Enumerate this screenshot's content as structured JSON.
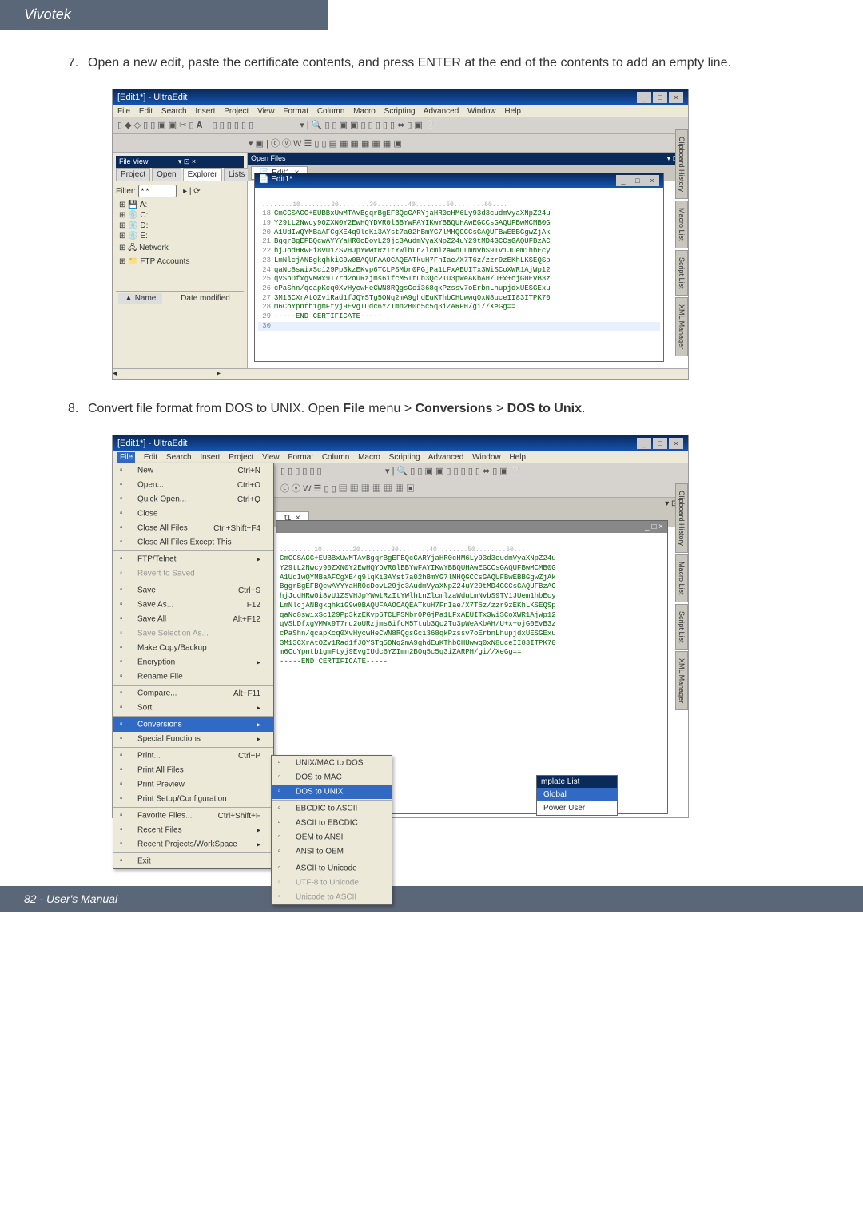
{
  "brand": "Vivotek",
  "steps": {
    "s7num": "7.",
    "s7": "Open a new edit, paste the certificate contents, and press ENTER at the end of the contents to add an empty line.",
    "s8num": "8.",
    "s8_pre": "Convert file format from DOS to UNIX. Open ",
    "s8_file": "File",
    "s8_mid1": " menu > ",
    "s8_conv": "Conversions",
    "s8_mid2": " > ",
    "s8_d2u": "DOS to Unix",
    "s8_end": "."
  },
  "screenshots": {
    "title": "[Edit1*] - UltraEdit",
    "menubar": [
      "File",
      "Edit",
      "Search",
      "Insert",
      "Project",
      "View",
      "Format",
      "Column",
      "Macro",
      "Scripting",
      "Advanced",
      "Window",
      "Help"
    ],
    "sidetabs": {
      "project": "Project",
      "open": "Open",
      "explorer": "Explorer",
      "lists": "Lists"
    },
    "filter_label": "Filter:",
    "tree": [
      "A:",
      "C:",
      "D:",
      "E:",
      "Network",
      "FTP Accounts"
    ],
    "bottom_headers": {
      "name": "Name",
      "date": "Date modified"
    },
    "editor_tab": "Edit1",
    "inner_title": "Edit1*",
    "ruler": ".........10........20........30........40........50........60....",
    "cert_lines": [
      "CmCGSAGG+EUBBxUwMTAvBgqrBgEFBQcCARYjaHR0cHM6Ly93d3cudmVyaXNpZ24u",
      "Y29tL2Nwcy90ZXN0Y2EwHQYDVR0lBBYwFAYIKwYBBQUHAwEGCCsGAQUFBwMCMB0G",
      "A1UdIwQYMBaAFCgXE4q9lqKi3AYst7a02hBmYG7lMHQGCCsGAQUFBwEBBGgwZjAk",
      "BggrBgEFBQcwAYYYaHR0cDovL29jc3AudmVyaXNpZ24uY29tMD4GCCsGAQUFBzAC",
      "hjJodHRw0i8vU1ZSVHJpYWwtRzItYWlhLnZlcmlzaWduLmNvbS9TV1JUem1hbEcy",
      "LmNlcjANBgkqhkiG9w0BAQUFAAOCAQEATkuH7FnIae/X7T6z/zzr9zEKhLKSEQSp",
      "qaNc8swixSc129Pp3kzEKvp6TCLPSMbr0PGjPa1LFxAEUITx3WiSCoXWR1AjWp12",
      "qVSbDfxgVMWx9T7rd2oURzjms6ifcM5Ttub3Qc2Tu3pWeAKbAH/U+x+ojG0EvB3z",
      "cPaShn/qcapKcq0XvHycwHeCWN8RQgsGci368qkPzssv7oErbnLhupjdxUESGExu",
      "3M13CXrAtOZv1Rad1fJQYSTg5ONq2mA9ghdEuKThbCHUwwq0xN8uceII83ITPK70",
      "m6CoYpntb1gmFtyj9EvgIUdc6YZImn2B0q5c5q3iZARPH/gi//XeGg=="
    ],
    "end_cert": "-----END CERTIFICATE-----",
    "vtabs": [
      "Clipboard History",
      "Macro List",
      "Script List",
      "XML Manager"
    ]
  },
  "file_menu": {
    "items": [
      {
        "label": "New",
        "shortcut": "Ctrl+N"
      },
      {
        "label": "Open...",
        "shortcut": "Ctrl+O"
      },
      {
        "label": "Quick Open...",
        "shortcut": "Ctrl+Q"
      },
      {
        "label": "Close",
        "shortcut": ""
      },
      {
        "label": "Close All Files",
        "shortcut": "Ctrl+Shift+F4"
      },
      {
        "label": "Close All Files Except This",
        "shortcut": ""
      },
      {
        "label": "FTP/Telnet",
        "shortcut": "",
        "arrow": true
      },
      {
        "label": "Revert to Saved",
        "shortcut": "",
        "disabled": true
      },
      {
        "label": "Save",
        "shortcut": "Ctrl+S"
      },
      {
        "label": "Save As...",
        "shortcut": "F12"
      },
      {
        "label": "Save All",
        "shortcut": "Alt+F12"
      },
      {
        "label": "Save Selection As...",
        "shortcut": "",
        "disabled": true
      },
      {
        "label": "Make Copy/Backup",
        "shortcut": ""
      },
      {
        "label": "Encryption",
        "shortcut": "",
        "arrow": true
      },
      {
        "label": "Rename File",
        "shortcut": ""
      },
      {
        "label": "Compare...",
        "shortcut": "Alt+F11"
      },
      {
        "label": "Sort",
        "shortcut": "",
        "arrow": true
      },
      {
        "label": "Conversions",
        "shortcut": "",
        "arrow": true,
        "hl": true
      },
      {
        "label": "Special Functions",
        "shortcut": "",
        "arrow": true
      },
      {
        "label": "Print...",
        "shortcut": "Ctrl+P"
      },
      {
        "label": "Print All Files",
        "shortcut": ""
      },
      {
        "label": "Print Preview",
        "shortcut": ""
      },
      {
        "label": "Print Setup/Configuration",
        "shortcut": ""
      },
      {
        "label": "Favorite Files...",
        "shortcut": "Ctrl+Shift+F"
      },
      {
        "label": "Recent Files",
        "shortcut": "",
        "arrow": true
      },
      {
        "label": "Recent Projects/WorkSpace",
        "shortcut": "",
        "arrow": true
      },
      {
        "label": "Exit",
        "shortcut": ""
      }
    ],
    "submenu": [
      {
        "label": "UNIX/MAC to DOS"
      },
      {
        "label": "DOS to MAC"
      },
      {
        "label": "DOS to UNIX",
        "hl": true
      },
      {
        "label": "EBCDIC to ASCII"
      },
      {
        "label": "ASCII to EBCDIC"
      },
      {
        "label": "OEM to ANSI"
      },
      {
        "label": "ANSI to OEM"
      },
      {
        "label": "ASCII to Unicode"
      },
      {
        "label": "UTF-8 to Unicode",
        "disabled": true
      },
      {
        "label": "Unicode to ASCII",
        "disabled": true
      }
    ],
    "template": {
      "header": "mplate List",
      "items": [
        "Global",
        "Power User"
      ]
    }
  },
  "footer": "82 - User's Manual"
}
